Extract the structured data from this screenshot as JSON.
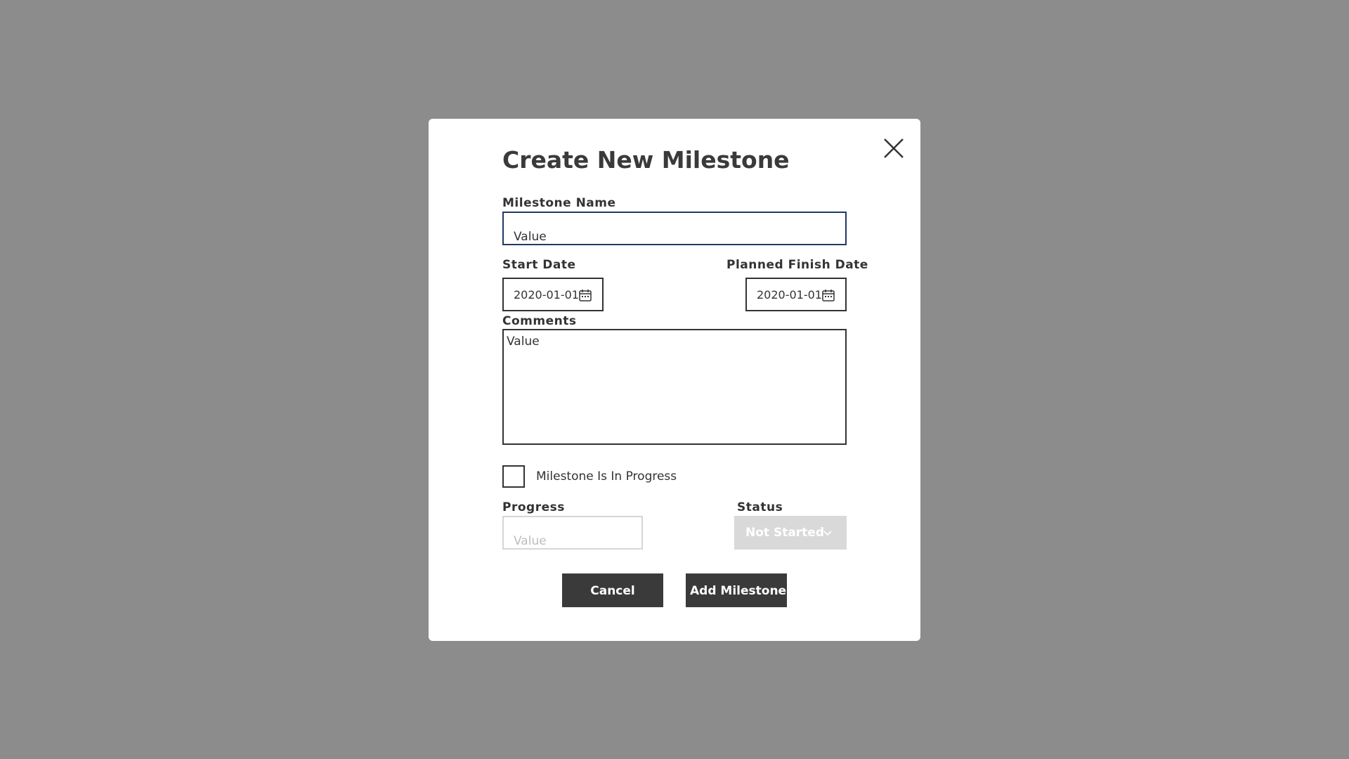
{
  "dialog": {
    "title": "Create New Milestone",
    "close_icon": "close-icon"
  },
  "milestone_name": {
    "label": "Milestone Name",
    "value": "Value"
  },
  "start_date": {
    "label": "Start Date",
    "value": "2020-01-01",
    "icon": "calendar-icon"
  },
  "planned_finish_date": {
    "label": "Planned Finish Date",
    "value": "2020-01-01",
    "icon": "calendar-icon"
  },
  "comments": {
    "label": "Comments",
    "value": "Value"
  },
  "in_progress": {
    "label": "Milestone Is In Progress",
    "checked": false
  },
  "progress": {
    "label": "Progress",
    "value": "Value",
    "disabled": true
  },
  "status": {
    "label": "Status",
    "value": "Not Started",
    "disabled": true,
    "icon": "chevron-down-icon"
  },
  "actions": {
    "cancel_label": "Cancel",
    "add_label": "Add Milestone"
  },
  "colors": {
    "backdrop": "#8c8c8c",
    "button_bg": "#3a3a3a",
    "focused_border": "#1f3a66",
    "disabled_bg": "#d9d9d9"
  }
}
